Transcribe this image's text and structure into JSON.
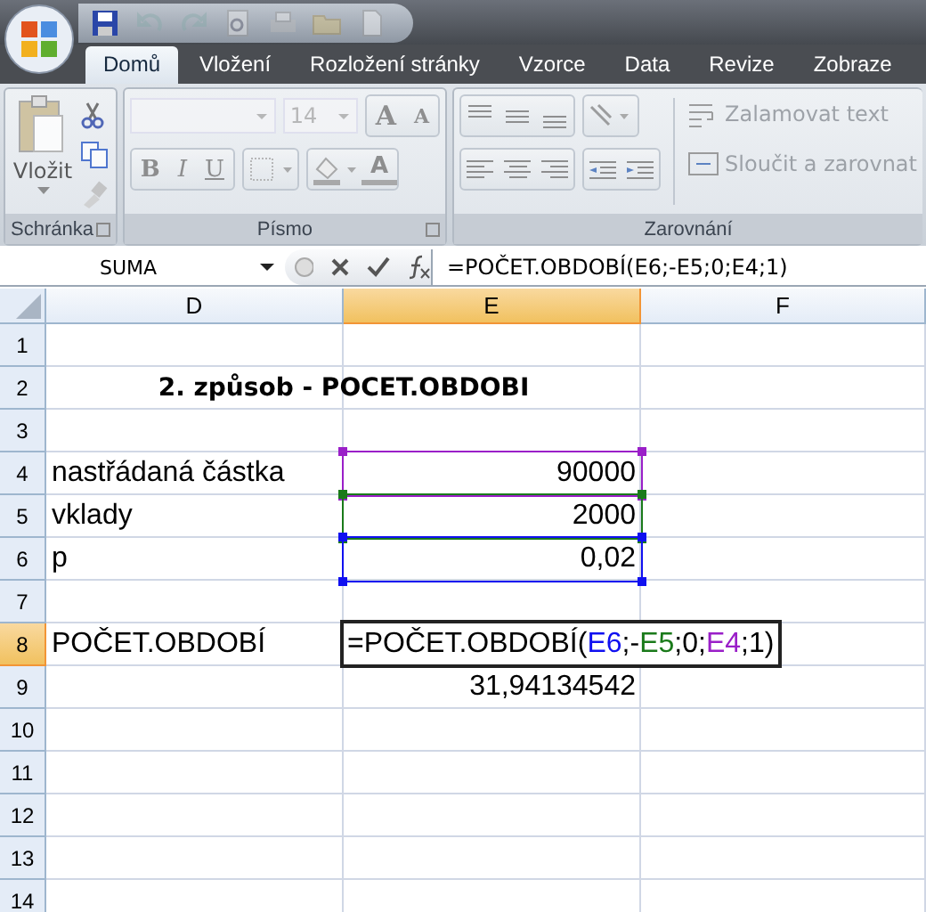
{
  "quick_access": [
    {
      "kind": "save",
      "disabled": false
    },
    {
      "kind": "undo",
      "disabled": true
    },
    {
      "kind": "redo",
      "disabled": true
    },
    {
      "kind": "preview",
      "disabled": true
    },
    {
      "kind": "print",
      "disabled": true
    },
    {
      "kind": "open",
      "disabled": true
    },
    {
      "kind": "new",
      "disabled": true
    }
  ],
  "tabs": [
    {
      "label": "Domů",
      "selected": true
    },
    {
      "label": "Vložení",
      "selected": false
    },
    {
      "label": "Rozložení stránky",
      "selected": false
    },
    {
      "label": "Vzorce",
      "selected": false
    },
    {
      "label": "Data",
      "selected": false
    },
    {
      "label": "Revize",
      "selected": false
    },
    {
      "label": "Zobraze",
      "selected": false
    }
  ],
  "ribbon": {
    "disabled": true,
    "clipboard": {
      "title": "Schránka",
      "paste_label": "Vložit"
    },
    "font": {
      "title": "Písmo",
      "font_size": "14",
      "grow_label": "A",
      "shrink_label": "A",
      "bold_label": "B",
      "italic_label": "I",
      "underline_label": "U",
      "color_label": "A"
    },
    "alignment": {
      "title": "Zarovnání",
      "wrap_label": "Zalamovat text",
      "merge_label": "Sloučit a zarovnat"
    }
  },
  "formula_bar": {
    "name_box": "SUMA",
    "formula": "=POČET.OBDOBÍ(E6;-E5;0;E4;1)"
  },
  "columns": [
    {
      "label": "D",
      "selected": false
    },
    {
      "label": "E",
      "selected": true
    },
    {
      "label": "F",
      "selected": false
    }
  ],
  "rows": [
    {
      "number": "1",
      "selected": false
    },
    {
      "number": "2",
      "selected": false,
      "title": "2. způsob - POCET.OBDOBI"
    },
    {
      "number": "3",
      "selected": false
    },
    {
      "number": "4",
      "selected": false,
      "label": "nastřádaná částka",
      "value": "90000",
      "color": "#9a1fc8"
    },
    {
      "number": "5",
      "selected": false,
      "label": "vklady",
      "value": "2000",
      "color": "#1a7a1a"
    },
    {
      "number": "6",
      "selected": false,
      "label": "p",
      "value": "0,02",
      "color": "#1010f0"
    },
    {
      "number": "7",
      "selected": false
    },
    {
      "number": "8",
      "selected": true,
      "label": "POČET.OBDOBÍ",
      "editing": [
        {
          "text": "=POČET.OBDOBÍ("
        },
        {
          "text": "E6",
          "color": "#1010f0"
        },
        {
          "text": ";-"
        },
        {
          "text": "E5",
          "color": "#1a7a1a"
        },
        {
          "text": ";0;"
        },
        {
          "text": "E4",
          "color": "#9a1fc8"
        },
        {
          "text": ";1)"
        }
      ]
    },
    {
      "number": "9",
      "selected": false,
      "value": "31,94134542"
    },
    {
      "number": "10",
      "selected": false
    },
    {
      "number": "11",
      "selected": false
    },
    {
      "number": "12",
      "selected": false
    },
    {
      "number": "13",
      "selected": false
    },
    {
      "number": "14",
      "selected": false
    }
  ]
}
